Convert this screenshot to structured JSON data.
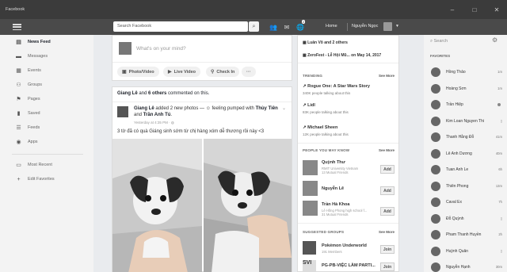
{
  "window": {
    "title": "Facebook",
    "controls": [
      "–",
      "□",
      "✕"
    ]
  },
  "navbar": {
    "search_placeholder": "Search Facebook",
    "home_label": "Home",
    "user_name": "Nguyễn Ngọc",
    "notification_count": "2"
  },
  "leftnav": {
    "items": [
      {
        "label": "News Feed",
        "icon": "news-feed-icon"
      },
      {
        "label": "Messages",
        "icon": "messages-icon"
      },
      {
        "label": "Events",
        "icon": "events-icon"
      },
      {
        "label": "Groups",
        "icon": "groups-icon"
      },
      {
        "label": "Pages",
        "icon": "pages-icon"
      },
      {
        "label": "Saved",
        "icon": "saved-icon"
      },
      {
        "label": "Feeds",
        "icon": "feeds-icon"
      },
      {
        "label": "Apps",
        "icon": "apps-icon"
      }
    ],
    "most_recent": "Most Recent",
    "edit_favorites": "Edit Favorites"
  },
  "composer": {
    "placeholder": "What's on your mind?",
    "photo_video": "Photo/Video",
    "live_video": "Live Video",
    "check_in": "Check In",
    "more": "···"
  },
  "post": {
    "commenter": "Giang Lê",
    "commented_mid": " and ",
    "others": "6 others",
    "commented_end": " commented on this.",
    "author": "Giang Lê",
    "action": " added 2 new photos — ",
    "feeling": "feeling pumped with ",
    "with1": "Thùy Tiên",
    "and": " and ",
    "with2": "Trần Anh Tú",
    "time": "Yesterday at 4:35 PM · ◍",
    "caption": "3 tờ đã có quà Giáng sinh sớm từ chị hàng xóm dễ thương rồi này <3"
  },
  "right": {
    "top1": "Luân Võ and 2 others",
    "top2": "ZeroFest - Lễ Hội Mũ... on May 14, 2017",
    "trending_title": "TRENDING",
    "see_more": "See More",
    "trending": [
      {
        "title": "Rogue One: A Star Wars Story",
        "sub": "340K people talking about this"
      },
      {
        "title": "Lidl",
        "sub": "83K people talking about this"
      },
      {
        "title": "Michael Sheen",
        "sub": "12K people talking about this"
      }
    ],
    "pymk_title": "PEOPLE YOU MAY KNOW",
    "pymk": [
      {
        "name": "Quỳnh Thư",
        "sub": "RMIT University Vietnam\n13 Mutual Friends",
        "btn": "Add"
      },
      {
        "name": "Nguyễn Lê",
        "sub": "",
        "btn": "Add"
      },
      {
        "name": "Trần Hà Khoa",
        "sub": "Lê Hồng Phong high school f...\n31 Mutual Friends",
        "btn": "Add"
      }
    ],
    "groups_title": "SUGGESTED GROUPS",
    "groups": [
      {
        "name": "Pokémon Underworld",
        "sub": "191 Members",
        "btn": "Join"
      },
      {
        "name": "PG-PB-VIỆC LÀM PARTI...",
        "sub": "",
        "btn": "Join"
      }
    ]
  },
  "chat": {
    "search_placeholder": "Search",
    "favorites_title": "FAVORITES",
    "people": [
      {
        "name": "Hồng Thảo",
        "time": "1m"
      },
      {
        "name": "Hoàng Sơn",
        "time": "1m"
      },
      {
        "name": "Trần Hiệp",
        "time": ""
      },
      {
        "name": "Kim Loan Nguyen Thi",
        "time": ""
      },
      {
        "name": "Thanh Hằng Đỗ",
        "time": "41m"
      },
      {
        "name": "Lê Anh Dương",
        "time": "40m"
      },
      {
        "name": "Tuan Anh Le",
        "time": "6h"
      },
      {
        "name": "Thiên Phong",
        "time": "13m"
      },
      {
        "name": "Caval Ex",
        "time": "7h"
      },
      {
        "name": "Đỗ Quỳnh",
        "time": ""
      },
      {
        "name": "Pham Thanh Huyền",
        "time": "2h"
      },
      {
        "name": "Huỳnh Quân",
        "time": ""
      },
      {
        "name": "Nguyễn Hạnh",
        "time": "30m"
      }
    ]
  }
}
